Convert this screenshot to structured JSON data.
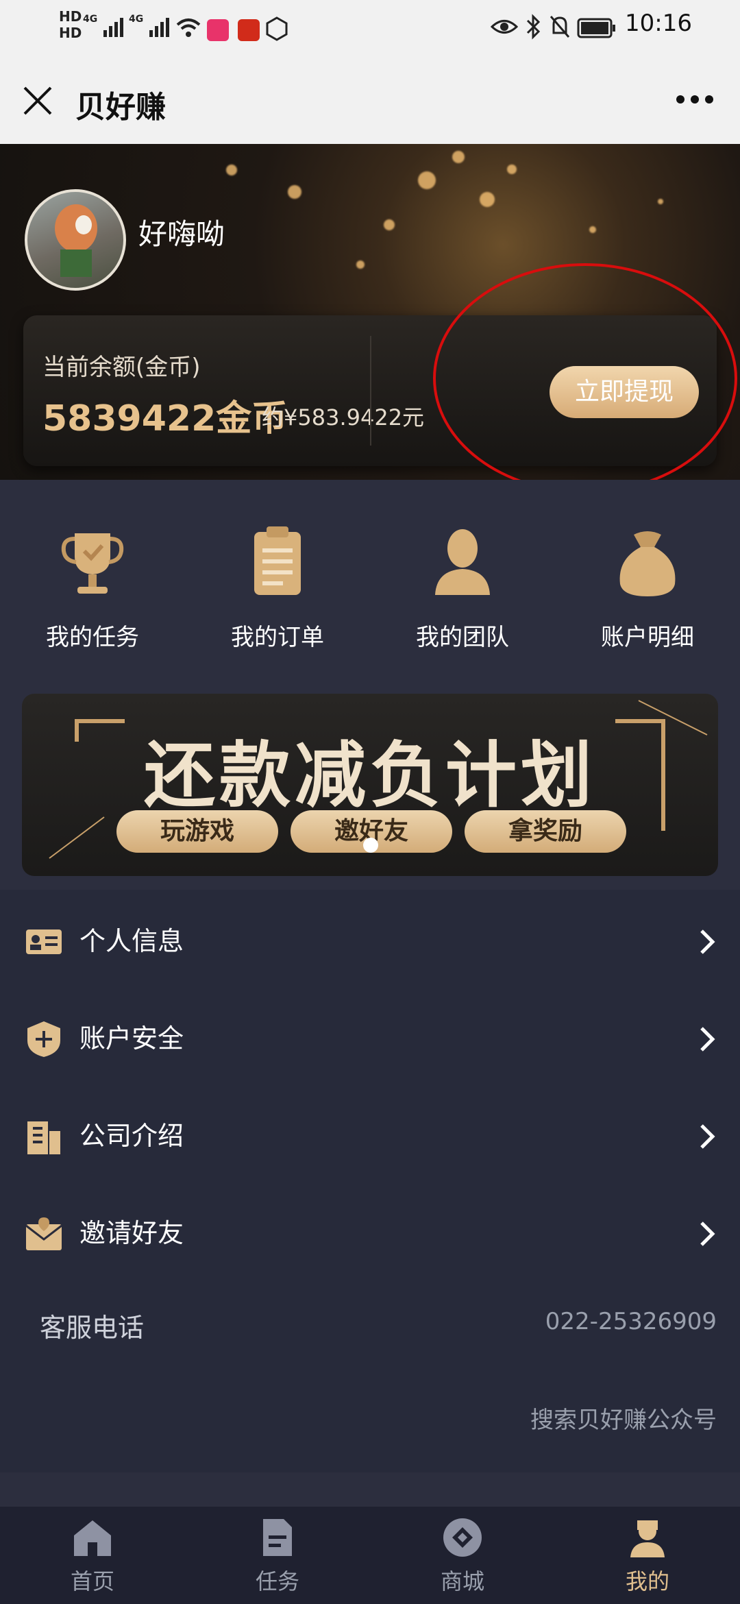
{
  "status": {
    "left_icons": "HD 4G 4G wifi",
    "time": "10:16"
  },
  "titlebar": {
    "title": "贝好赚"
  },
  "profile": {
    "username": "好嗨呦"
  },
  "balance": {
    "label": "当前余额(金币)",
    "value": "5839422金币",
    "approx": "约¥583.9422元",
    "withdraw_label": "立即提现"
  },
  "quick_actions": [
    {
      "label": "我的任务",
      "icon": "trophy-icon"
    },
    {
      "label": "我的订单",
      "icon": "clipboard-icon"
    },
    {
      "label": "我的团队",
      "icon": "person-icon"
    },
    {
      "label": "账户明细",
      "icon": "money-bag-icon"
    }
  ],
  "banner": {
    "title": "还款减负计划",
    "pills": [
      "玩游戏",
      "邀好友",
      "拿奖励"
    ]
  },
  "menu": [
    {
      "label": "个人信息",
      "icon": "id-card-icon"
    },
    {
      "label": "账户安全",
      "icon": "shield-icon"
    },
    {
      "label": "公司介绍",
      "icon": "building-icon"
    },
    {
      "label": "邀请好友",
      "icon": "invite-envelope-icon"
    }
  ],
  "hotline": {
    "label": "客服电话",
    "number": "022-25326909"
  },
  "official_hint": "搜索贝好赚公众号",
  "bottom_nav": [
    {
      "label": "首页",
      "icon": "home-icon",
      "active": false
    },
    {
      "label": "任务",
      "icon": "task-document-icon",
      "active": false
    },
    {
      "label": "商城",
      "icon": "shop-icon",
      "active": false
    },
    {
      "label": "我的",
      "icon": "profile-icon",
      "active": true
    }
  ],
  "colors": {
    "gold": "#e7c28d",
    "background": "#2c2e3e",
    "annotation": "#d80d0d"
  }
}
